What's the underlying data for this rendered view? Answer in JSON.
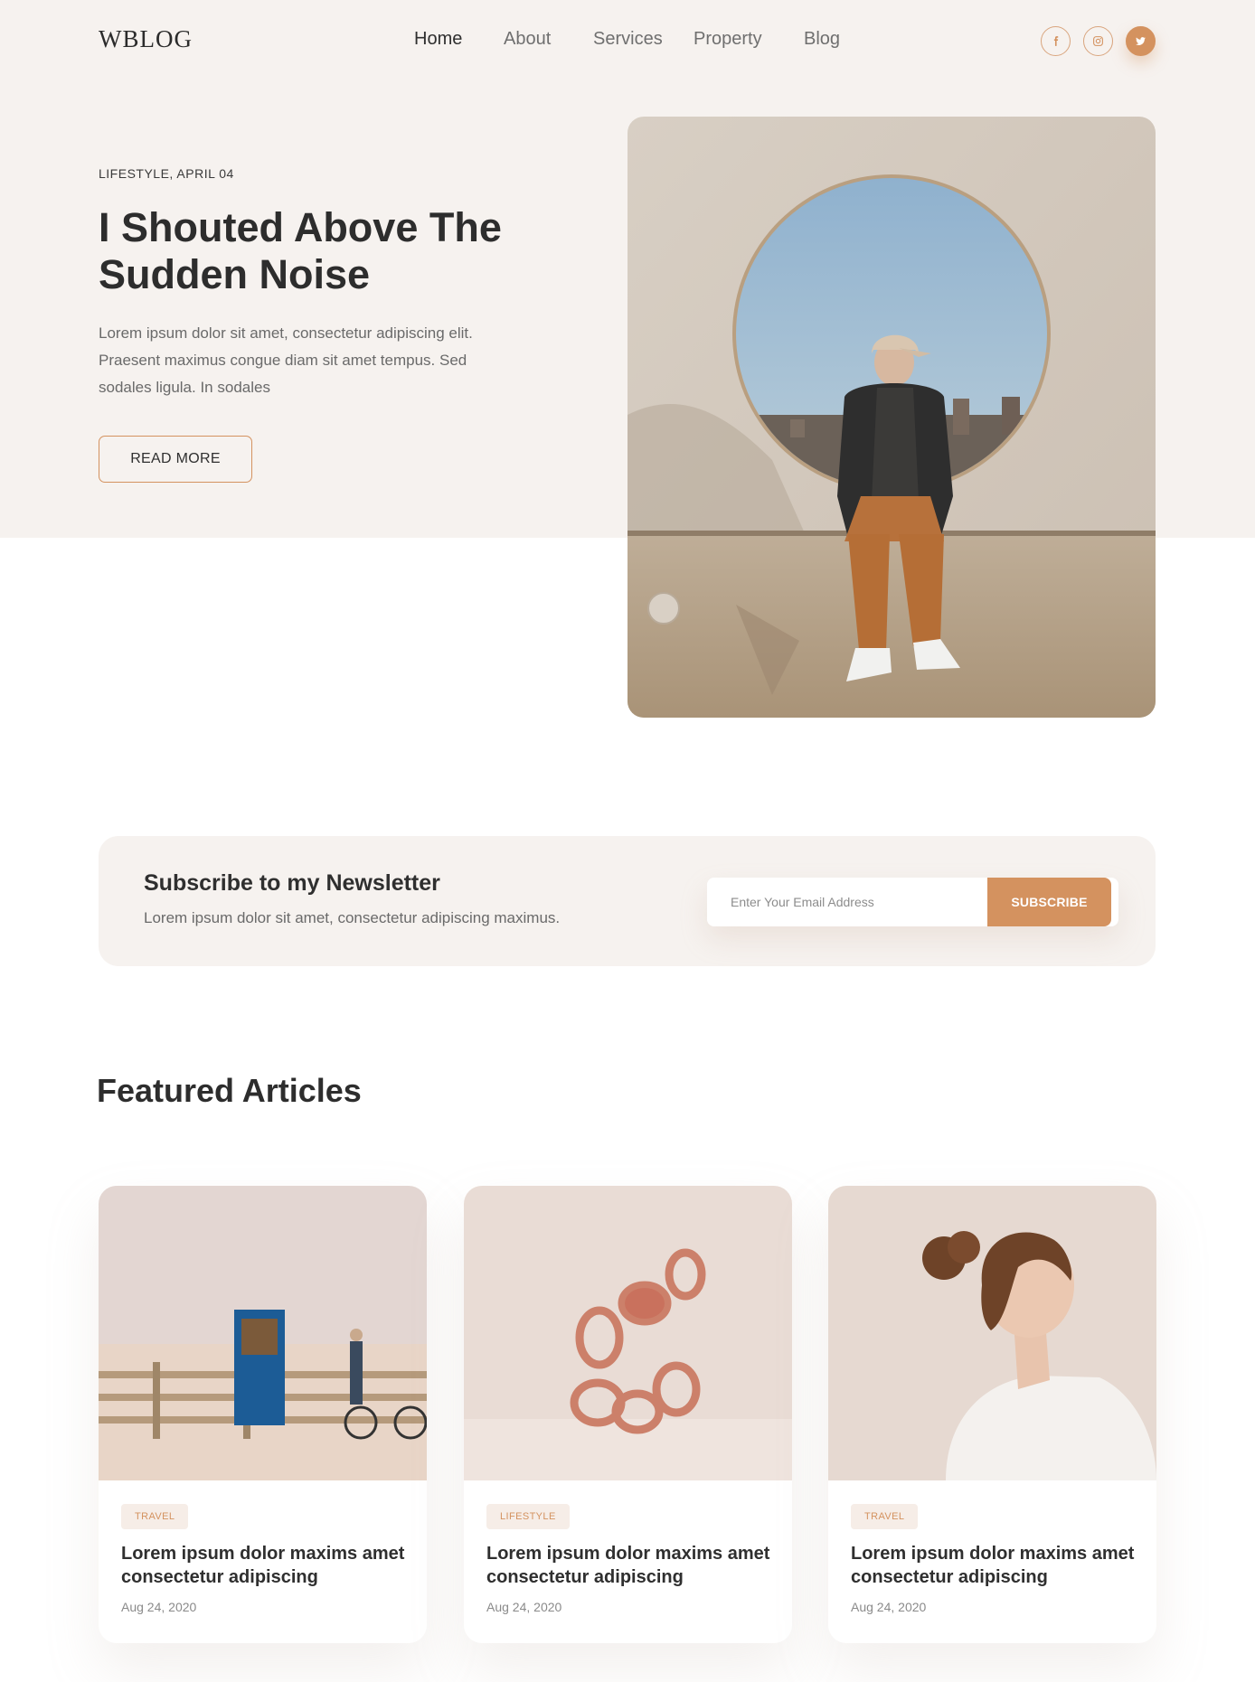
{
  "header": {
    "logo": "WBLOG",
    "nav": [
      {
        "label": "Home",
        "active": true
      },
      {
        "label": "About",
        "active": false
      },
      {
        "label": "Services",
        "active": false
      },
      {
        "label": "Property",
        "active": false
      },
      {
        "label": "Blog",
        "active": false
      }
    ],
    "social": [
      "facebook-icon",
      "instagram-icon",
      "twitter-icon"
    ]
  },
  "hero": {
    "meta": "LIFESTYLE, APRIL 04",
    "title": "I Shouted Above The Sudden Noise",
    "text": "Lorem ipsum dolor sit amet, consectetur adipiscing elit. Praesent maximus congue diam sit amet tempus. Sed sodales ligula. In sodales",
    "button": "READ MORE"
  },
  "newsletter": {
    "title": "Subscribe to my Newsletter",
    "text": "Lorem ipsum dolor sit amet, consectetur adipiscing maximus.",
    "placeholder": "Enter Your Email Address",
    "button": "SUBSCRIBE"
  },
  "featured": {
    "title": "Featured Articles",
    "cards": [
      {
        "tag": "TRAVEL",
        "title": "Lorem ipsum dolor maxims amet consectetur adipiscing",
        "date": "Aug 24, 2020"
      },
      {
        "tag": "LIFESTYLE",
        "title": "Lorem ipsum dolor maxims amet consectetur adipiscing",
        "date": "Aug 24, 2020"
      },
      {
        "tag": "TRAVEL",
        "title": "Lorem ipsum dolor maxims amet consectetur adipiscing",
        "date": "Aug 24, 2020"
      }
    ]
  },
  "colors": {
    "accent": "#d4925f",
    "hero_bg": "#f6f2ef",
    "text_dark": "#2f2f2f",
    "text_muted": "#6a6a6a"
  }
}
